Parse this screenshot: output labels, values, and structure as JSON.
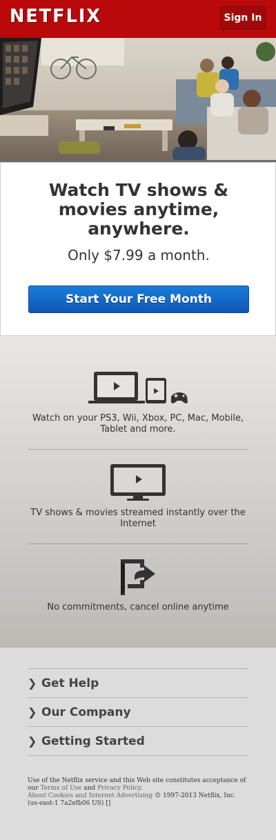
{
  "header": {
    "logo": "NETFLIX",
    "signin_label": "Sign In",
    "brand_color": "#b9090b"
  },
  "promo": {
    "headline": "Watch TV shows & movies anytime, anywhere.",
    "price_text": "Only $7.99 a month.",
    "cta_label": "Start Your Free Month",
    "cta_color": "#1a6bc8"
  },
  "features": [
    {
      "icon": "devices-icon",
      "text": "Watch on your PS3, Wii, Xbox, PC, Mac, Mobile, Tablet and more."
    },
    {
      "icon": "tv-icon",
      "text": "TV shows & movies streamed instantly over the Internet"
    },
    {
      "icon": "exit-door-icon",
      "text": "No commitments, cancel online anytime"
    }
  ],
  "footer": {
    "links": [
      "Get Help",
      "Our Company",
      "Getting Started"
    ],
    "legal": {
      "line1": "Use of the Netflix service and this Web site constitutes acceptance of our",
      "terms": "Terms of Use",
      "and": "and",
      "privacy": "Privacy Policy",
      "period": ".",
      "cookies": "About Cookies and Internet Advertising",
      "copyright": "© 1997-2013 Netflix, Inc. (us-east-1 7a2efb06 US) []"
    }
  }
}
